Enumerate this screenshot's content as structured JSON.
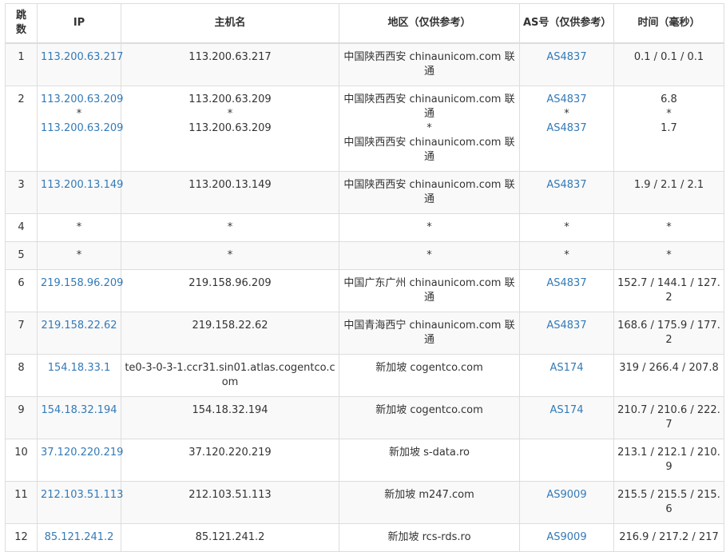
{
  "headers": {
    "hop": "跳数",
    "ip": "IP",
    "host": "主机名",
    "region": "地区（仅供参考）",
    "as": "AS号（仅供参考）",
    "time": "时间（毫秒）"
  },
  "rows": [
    {
      "hop": "1",
      "ip": [
        "113.200.63.217"
      ],
      "host": [
        "113.200.63.217"
      ],
      "region": [
        "中国陕西西安 chinaunicom.com 联通"
      ],
      "as": [
        "AS4837"
      ],
      "time": [
        "0.1 / 0.1 / 0.1"
      ]
    },
    {
      "hop": "2",
      "ip": [
        "113.200.63.209",
        "*",
        "113.200.63.209"
      ],
      "host": [
        "113.200.63.209",
        "*",
        "113.200.63.209"
      ],
      "region": [
        "中国陕西西安 chinaunicom.com 联通",
        "*",
        "中国陕西西安 chinaunicom.com 联通"
      ],
      "as": [
        "AS4837",
        "*",
        "AS4837"
      ],
      "time": [
        "6.8",
        "*",
        "1.7"
      ]
    },
    {
      "hop": "3",
      "ip": [
        "113.200.13.149"
      ],
      "host": [
        "113.200.13.149"
      ],
      "region": [
        "中国陕西西安 chinaunicom.com 联通"
      ],
      "as": [
        "AS4837"
      ],
      "time": [
        "1.9 / 2.1 / 2.1"
      ]
    },
    {
      "hop": "4",
      "ip": [
        "*"
      ],
      "host": [
        "*"
      ],
      "region": [
        "*"
      ],
      "as": [
        "*"
      ],
      "time": [
        "*"
      ]
    },
    {
      "hop": "5",
      "ip": [
        "*"
      ],
      "host": [
        "*"
      ],
      "region": [
        "*"
      ],
      "as": [
        "*"
      ],
      "time": [
        "*"
      ]
    },
    {
      "hop": "6",
      "ip": [
        "219.158.96.209"
      ],
      "host": [
        "219.158.96.209"
      ],
      "region": [
        "中国广东广州 chinaunicom.com 联通"
      ],
      "as": [
        "AS4837"
      ],
      "time": [
        "152.7 / 144.1 / 127.2"
      ]
    },
    {
      "hop": "7",
      "ip": [
        "219.158.22.62"
      ],
      "host": [
        "219.158.22.62"
      ],
      "region": [
        "中国青海西宁 chinaunicom.com 联通"
      ],
      "as": [
        "AS4837"
      ],
      "time": [
        "168.6 / 175.9 / 177.2"
      ]
    },
    {
      "hop": "8",
      "ip": [
        "154.18.33.1"
      ],
      "host": [
        "te0-3-0-3-1.ccr31.sin01.atlas.cogentco.com"
      ],
      "region": [
        "新加坡 cogentco.com"
      ],
      "as": [
        "AS174"
      ],
      "time": [
        "319 / 266.4 / 207.8"
      ]
    },
    {
      "hop": "9",
      "ip": [
        "154.18.32.194"
      ],
      "host": [
        "154.18.32.194"
      ],
      "region": [
        "新加坡 cogentco.com"
      ],
      "as": [
        "AS174"
      ],
      "time": [
        "210.7 / 210.6 / 222.7"
      ]
    },
    {
      "hop": "10",
      "ip": [
        "37.120.220.219"
      ],
      "host": [
        "37.120.220.219"
      ],
      "region": [
        "新加坡 s-data.ro"
      ],
      "as": [
        ""
      ],
      "time": [
        "213.1 / 212.1 / 210.9"
      ]
    },
    {
      "hop": "11",
      "ip": [
        "212.103.51.113"
      ],
      "host": [
        "212.103.51.113"
      ],
      "region": [
        "新加坡 m247.com"
      ],
      "as": [
        "AS9009"
      ],
      "time": [
        "215.5 / 215.5 / 215.6"
      ]
    },
    {
      "hop": "12",
      "ip": [
        "85.121.241.2"
      ],
      "host": [
        "85.121.241.2"
      ],
      "region": [
        "新加坡 rcs-rds.ro"
      ],
      "as": [
        "AS9009"
      ],
      "time": [
        "216.9 / 217.2 / 217"
      ]
    }
  ]
}
